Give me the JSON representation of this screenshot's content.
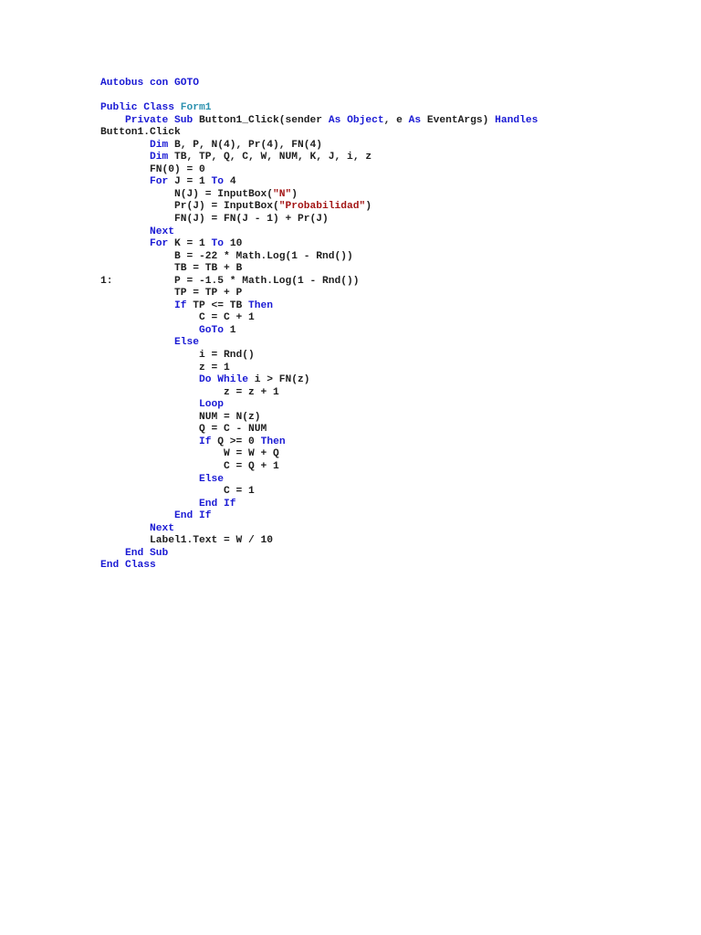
{
  "colors": {
    "keyword": "#1a1ad4",
    "type": "#2b91af",
    "string": "#a31515",
    "text": "#1e1e1e"
  },
  "lines": [
    [
      [
        "Autobus con GOTO",
        "k"
      ]
    ],
    [],
    [
      [
        "Public Class ",
        "k"
      ],
      [
        "Form1",
        "t"
      ]
    ],
    [
      [
        "    "
      ],
      [
        "Private Sub ",
        "k"
      ],
      [
        "Button1_Click(sender ",
        "n"
      ],
      [
        "As Object",
        "k"
      ],
      [
        ", e ",
        "n"
      ],
      [
        "As ",
        "k"
      ],
      [
        "EventArgs) ",
        "n"
      ],
      [
        "Handles",
        "k"
      ]
    ],
    [
      [
        "Button1.Click",
        "n"
      ]
    ],
    [
      [
        "        "
      ],
      [
        "Dim ",
        "k"
      ],
      [
        "B, P, N(4), Pr(4), FN(4)",
        "n"
      ]
    ],
    [
      [
        "        "
      ],
      [
        "Dim ",
        "k"
      ],
      [
        "TB, TP, Q, C, W, NUM, K, J, i, z",
        "n"
      ]
    ],
    [
      [
        "        FN(0) = 0",
        "n"
      ]
    ],
    [
      [
        "        "
      ],
      [
        "For ",
        "k"
      ],
      [
        "J = 1 ",
        "n"
      ],
      [
        "To ",
        "k"
      ],
      [
        "4",
        "n"
      ]
    ],
    [
      [
        "            N(J) = InputBox(",
        "n"
      ],
      [
        "\"N\"",
        "s"
      ],
      [
        ")",
        "n"
      ]
    ],
    [
      [
        "            Pr(J) = InputBox(",
        "n"
      ],
      [
        "\"Probabilidad\"",
        "s"
      ],
      [
        ")",
        "n"
      ]
    ],
    [
      [
        "            FN(J) = FN(J - 1) + Pr(J)",
        "n"
      ]
    ],
    [
      [
        "        "
      ],
      [
        "Next",
        "k"
      ]
    ],
    [
      [
        "        "
      ],
      [
        "For ",
        "k"
      ],
      [
        "K = 1 ",
        "n"
      ],
      [
        "To ",
        "k"
      ],
      [
        "10",
        "n"
      ]
    ],
    [
      [
        "            B = -22 * Math.Log(1 - Rnd())",
        "n"
      ]
    ],
    [
      [
        "            TB = TB + B",
        "n"
      ]
    ],
    [
      [
        "1:          P = -1.5 * Math.Log(1 - Rnd())",
        "n"
      ]
    ],
    [
      [
        "            TP = TP + P",
        "n"
      ]
    ],
    [
      [
        "            "
      ],
      [
        "If ",
        "k"
      ],
      [
        "TP <= TB ",
        "n"
      ],
      [
        "Then",
        "k"
      ]
    ],
    [
      [
        "                C = C + 1",
        "n"
      ]
    ],
    [
      [
        "                "
      ],
      [
        "GoTo ",
        "k"
      ],
      [
        "1",
        "n"
      ]
    ],
    [
      [
        "            "
      ],
      [
        "Else",
        "k"
      ]
    ],
    [
      [
        "                i = Rnd()",
        "n"
      ]
    ],
    [
      [
        "                z = 1",
        "n"
      ]
    ],
    [
      [
        "                "
      ],
      [
        "Do While ",
        "k"
      ],
      [
        "i > FN(z)",
        "n"
      ]
    ],
    [
      [
        "                    z = z + 1",
        "n"
      ]
    ],
    [
      [
        "                "
      ],
      [
        "Loop",
        "k"
      ]
    ],
    [
      [
        "                NUM = N(z)",
        "n"
      ]
    ],
    [
      [
        "                Q = C - NUM",
        "n"
      ]
    ],
    [
      [
        "                "
      ],
      [
        "If ",
        "k"
      ],
      [
        "Q >= 0 ",
        "n"
      ],
      [
        "Then",
        "k"
      ]
    ],
    [
      [
        "                    W = W + Q",
        "n"
      ]
    ],
    [
      [
        "                    C = Q + 1",
        "n"
      ]
    ],
    [
      [
        "                "
      ],
      [
        "Else",
        "k"
      ]
    ],
    [
      [
        "                    C = 1",
        "n"
      ]
    ],
    [
      [
        "                "
      ],
      [
        "End If",
        "k"
      ]
    ],
    [
      [
        "            "
      ],
      [
        "End If",
        "k"
      ]
    ],
    [
      [
        "        "
      ],
      [
        "Next",
        "k"
      ]
    ],
    [
      [
        "        Label1.Text = W / 10",
        "n"
      ]
    ],
    [
      [
        "    "
      ],
      [
        "End Sub",
        "k"
      ]
    ],
    [
      [
        "End Class",
        "k"
      ]
    ]
  ]
}
